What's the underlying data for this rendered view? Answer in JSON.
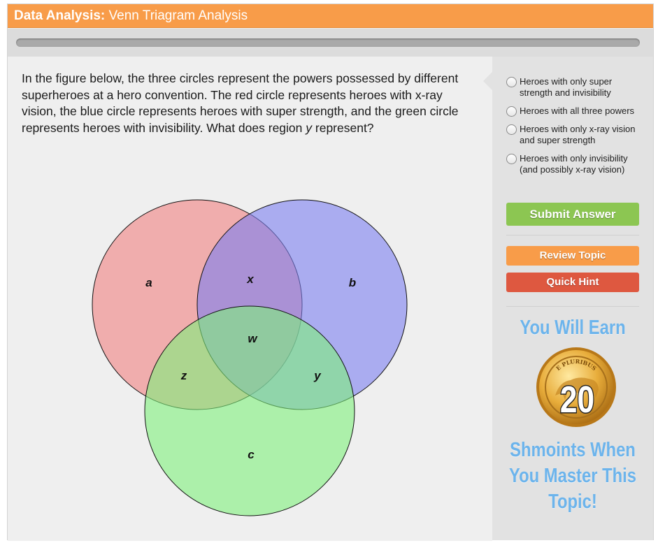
{
  "header": {
    "topic_label": "Data Analysis:",
    "topic_name": "Venn Triagram Analysis"
  },
  "progress": {
    "fraction": 0.0
  },
  "question": {
    "text_before": "In the figure below, the three circles represent the powers possessed by different superheroes at a hero convention. The red circle represents heroes with x-ray vision, the blue circle represents heroes with super strength, and the green circle represents heroes with invisibility. What does region ",
    "variable": "y",
    "text_after": " represent?"
  },
  "venn": {
    "circles": [
      {
        "name": "red",
        "color": "#f08080"
      },
      {
        "name": "blue",
        "color": "#7b7ff0"
      },
      {
        "name": "green",
        "color": "#7ff07b"
      }
    ],
    "labels": {
      "a": "a",
      "x": "x",
      "b": "b",
      "w": "w",
      "z": "z",
      "y": "y",
      "c": "c"
    }
  },
  "options": [
    {
      "label": "Heroes with only super strength and invisibility"
    },
    {
      "label": "Heroes with all three powers"
    },
    {
      "label": "Heroes with only x-ray vision and super strength"
    },
    {
      "label": "Heroes with only invisibility (and possibly x-ray vision)"
    }
  ],
  "buttons": {
    "submit": "Submit Answer",
    "review": "Review Topic",
    "hint": "Quick Hint"
  },
  "reward": {
    "title": "You Will Earn",
    "amount": "20",
    "coin_text": "E PLURIBUS",
    "line1": "Shmoints When",
    "line2": "You Master This",
    "line3": "Topic!"
  },
  "colors": {
    "accent": "#f89c49",
    "submit": "#8cc652",
    "hint": "#de5840",
    "reward_text": "#6cb4ec"
  }
}
